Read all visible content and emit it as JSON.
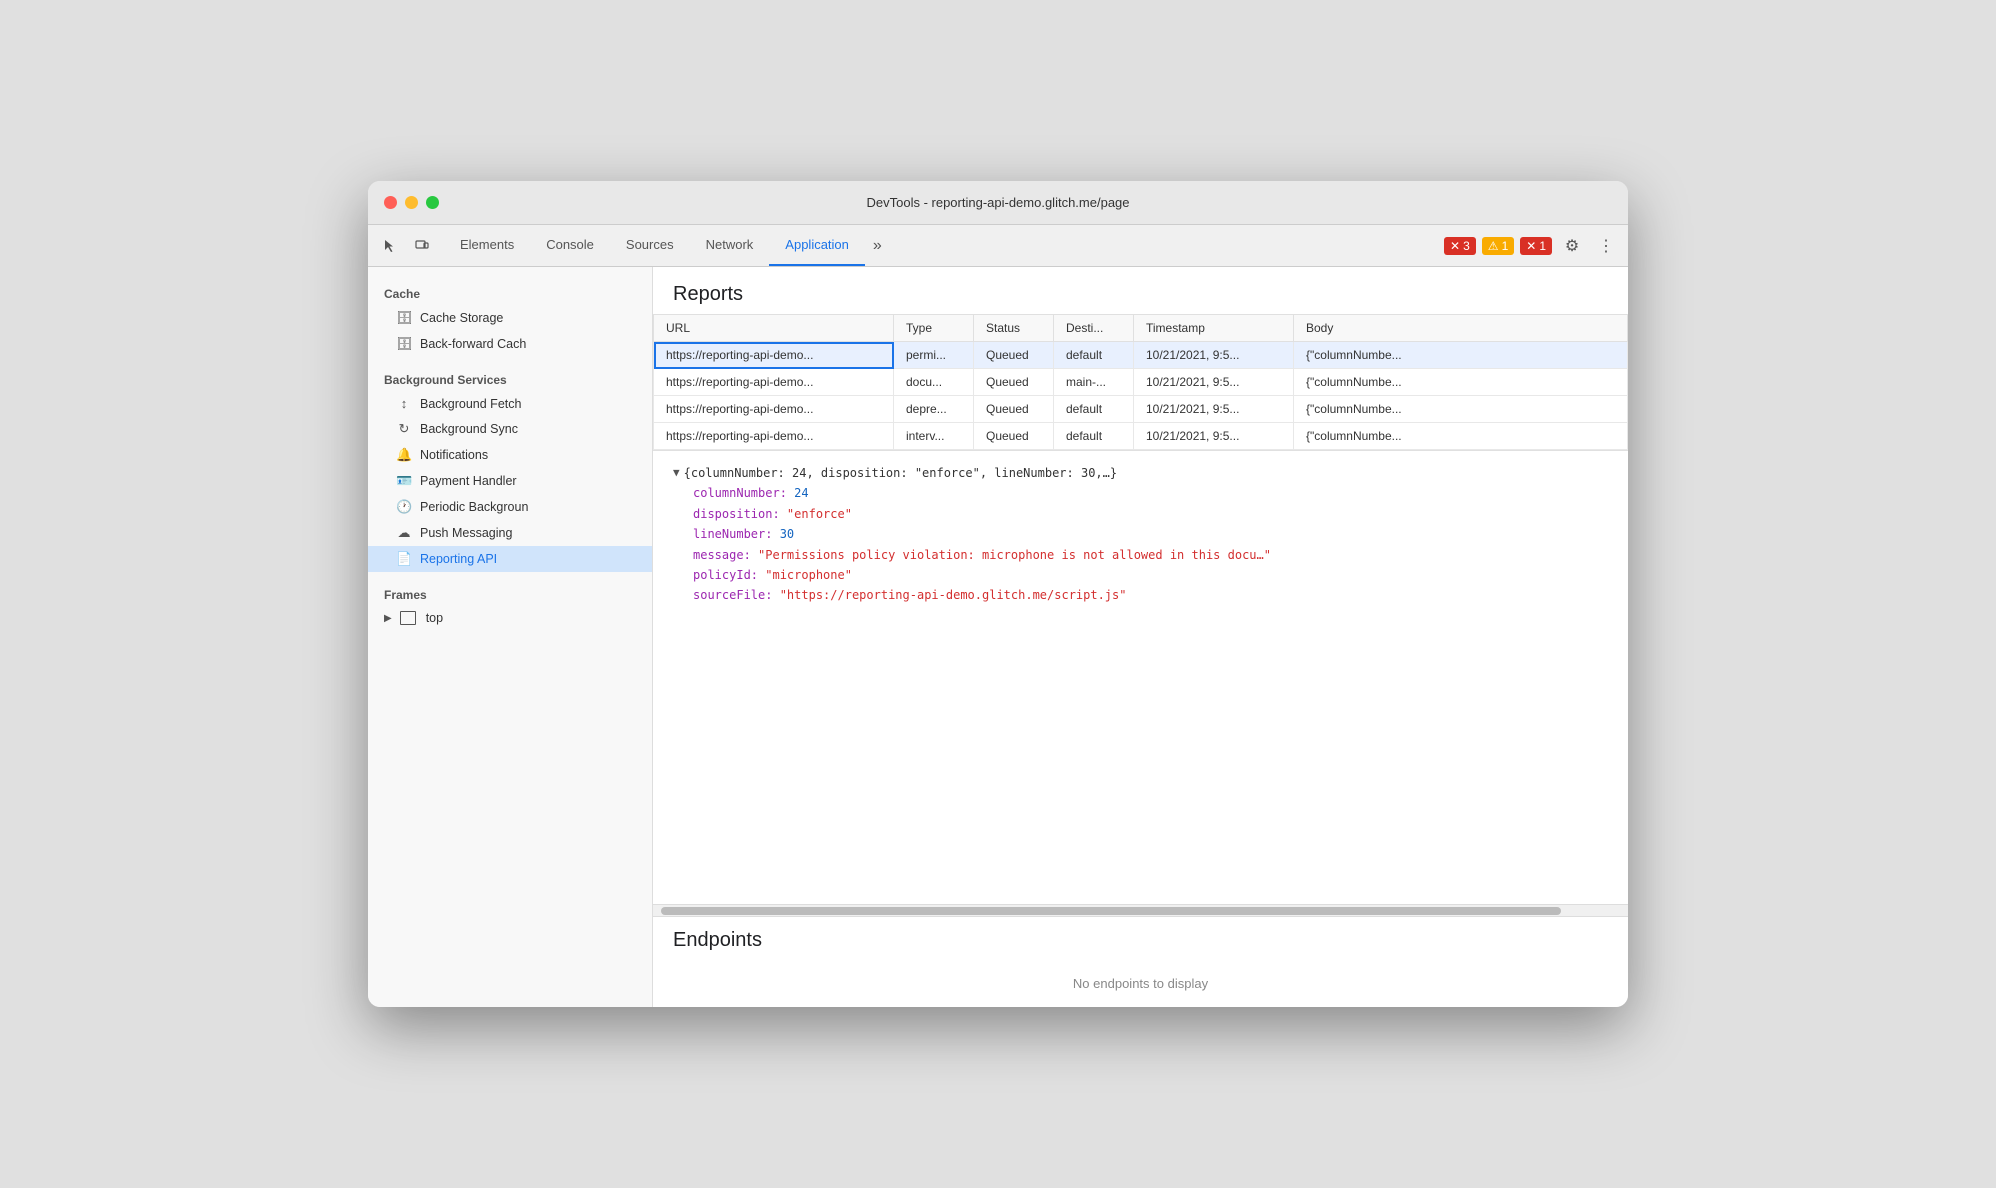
{
  "window": {
    "title": "DevTools - reporting-api-demo.glitch.me/page"
  },
  "toolbar": {
    "tabs": [
      {
        "id": "elements",
        "label": "Elements",
        "active": false
      },
      {
        "id": "console",
        "label": "Console",
        "active": false
      },
      {
        "id": "sources",
        "label": "Sources",
        "active": false
      },
      {
        "id": "network",
        "label": "Network",
        "active": false
      },
      {
        "id": "application",
        "label": "Application",
        "active": true
      }
    ],
    "more_label": "»",
    "badge_error_icon": "✕",
    "badge_error_count": "3",
    "badge_warning_icon": "⚠",
    "badge_warning_count": "1",
    "badge_x_icon": "✕",
    "badge_x_count": "1",
    "gear_icon": "⚙",
    "dots_icon": "⋮"
  },
  "sidebar": {
    "cache_label": "Cache",
    "cache_storage_label": "Cache Storage",
    "back_forward_cache_label": "Back-forward Cach",
    "background_services_label": "Background Services",
    "background_fetch_label": "Background Fetch",
    "background_sync_label": "Background Sync",
    "notifications_label": "Notifications",
    "payment_handler_label": "Payment Handler",
    "periodic_background_label": "Periodic Backgroun",
    "push_messaging_label": "Push Messaging",
    "reporting_api_label": "Reporting API",
    "frames_label": "Frames",
    "top_label": "top"
  },
  "reports": {
    "section_title": "Reports",
    "columns": [
      "URL",
      "Type",
      "Status",
      "Desti...",
      "Timestamp",
      "Body"
    ],
    "rows": [
      {
        "url": "https://reporting-api-demo...",
        "type": "permi...",
        "status": "Queued",
        "destination": "default",
        "timestamp": "10/21/2021, 9:5...",
        "body": "{\"columnNumbe...",
        "selected": true
      },
      {
        "url": "https://reporting-api-demo...",
        "type": "docu...",
        "status": "Queued",
        "destination": "main-...",
        "timestamp": "10/21/2021, 9:5...",
        "body": "{\"columnNumbe...",
        "selected": false
      },
      {
        "url": "https://reporting-api-demo...",
        "type": "depre...",
        "status": "Queued",
        "destination": "default",
        "timestamp": "10/21/2021, 9:5...",
        "body": "{\"columnNumbe...",
        "selected": false
      },
      {
        "url": "https://reporting-api-demo...",
        "type": "interv...",
        "status": "Queued",
        "destination": "default",
        "timestamp": "10/21/2021, 9:5...",
        "body": "{\"columnNumbe...",
        "selected": false
      }
    ],
    "detail": {
      "summary": "{columnNumber: 24, disposition: \"enforce\", lineNumber: 30,…}",
      "lines": [
        {
          "key": "columnNumber",
          "value": "24",
          "type": "num"
        },
        {
          "key": "disposition",
          "value": "\"enforce\"",
          "type": "str"
        },
        {
          "key": "lineNumber",
          "value": "30",
          "type": "num"
        },
        {
          "key": "message",
          "value": "\"Permissions policy violation: microphone is not allowed in this docu…\"",
          "type": "str"
        },
        {
          "key": "policyId",
          "value": "\"microphone\"",
          "type": "str"
        },
        {
          "key": "sourceFile",
          "value": "\"https://reporting-api-demo.glitch.me/script.js\"",
          "type": "str"
        }
      ]
    }
  },
  "endpoints": {
    "section_title": "Endpoints",
    "empty_message": "No endpoints to display"
  }
}
